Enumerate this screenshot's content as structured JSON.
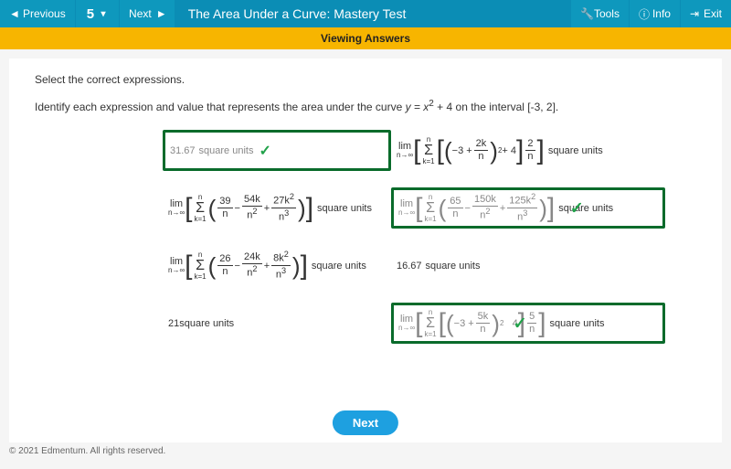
{
  "topbar": {
    "previous": "Previous",
    "questionNumber": "5",
    "next": "Next",
    "title": "The Area Under a Curve: Mastery Test",
    "tools": "Tools",
    "info": "Info",
    "exit": "Exit"
  },
  "subbar": {
    "text": "Viewing Answers"
  },
  "content": {
    "instruction": "Select the correct expressions.",
    "question_prefix": "Identify each expression and value that represents the area under the curve ",
    "question_func": "y = x",
    "question_exp": "2",
    "question_mid": " + 4 on the interval ",
    "question_interval": "[-3, 2].",
    "units_label": "square units"
  },
  "options": {
    "a": {
      "value": "31.67",
      "correct": true
    },
    "b": {
      "correct": false,
      "paren_inner_lead": "−3 +",
      "frac1_num": "2k",
      "frac1_den": "n",
      "exp": "2",
      "plus4": "+ 4",
      "frac2_num": "2",
      "frac2_den": "n"
    },
    "c": {
      "correct": false,
      "f1n": "39",
      "f1d": "n",
      "minus1": "−",
      "f2n": "54k",
      "f2d": "n",
      "f2d_exp": "2",
      "plus1": "+",
      "f3n": "27k",
      "f3n_exp": "2",
      "f3d": "n",
      "f3d_exp": "3"
    },
    "d": {
      "correct": true,
      "f1n": "65",
      "f1d": "n",
      "minus1": "−",
      "f2n": "150k",
      "f2d": "n",
      "f2d_exp": "2",
      "plus1": "+",
      "f3n": "125k",
      "f3n_exp": "2",
      "f3d": "n",
      "f3d_exp": "3"
    },
    "e": {
      "correct": false,
      "f1n": "26",
      "f1d": "n",
      "minus1": "−",
      "f2n": "24k",
      "f2d": "n",
      "f2d_exp": "2",
      "plus1": "+",
      "f3n": "8k",
      "f3n_exp": "2",
      "f3d": "n",
      "f3d_exp": "3"
    },
    "f": {
      "value": "16.67",
      "correct": false
    },
    "g": {
      "value": "21",
      "correct": false
    },
    "h": {
      "correct": true,
      "paren_inner_lead": "−3 +",
      "frac1_num": "5k",
      "frac1_den": "n",
      "exp": "2",
      "plus4": "4",
      "frac2_num": "5",
      "frac2_den": "n"
    }
  },
  "lim": {
    "top": "lim",
    "bot": "n→∞"
  },
  "sigma": {
    "top": "n",
    "mid": "Σ",
    "bot": "k=1"
  },
  "buttons": {
    "next": "Next"
  },
  "footer": {
    "copyright": "© 2021 Edmentum. All rights reserved."
  }
}
